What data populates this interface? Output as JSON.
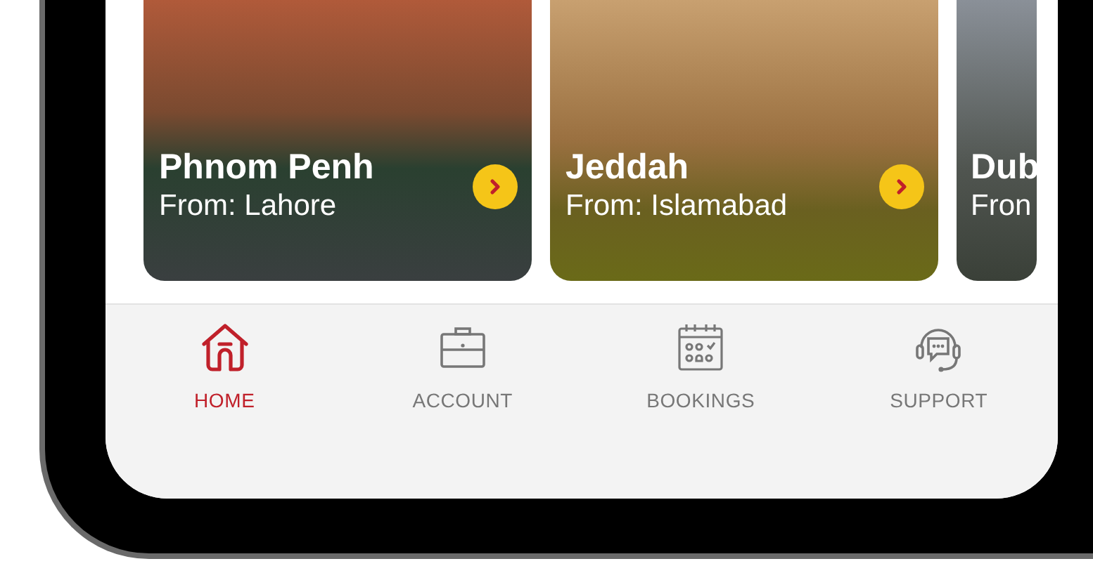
{
  "destinations": [
    {
      "title": "Phnom Penh",
      "origin": "From: Lahore",
      "arrow": true
    },
    {
      "title": "Jeddah",
      "origin": "From: Islamabad",
      "arrow": true
    },
    {
      "title": "Dub",
      "origin": "Fron",
      "arrow": false
    }
  ],
  "tab_bar": [
    {
      "label": "HOME",
      "kind": "home",
      "selected": true
    },
    {
      "label": "ACCOUNT",
      "kind": "account",
      "selected": false
    },
    {
      "label": "BOOKINGS",
      "kind": "bookings",
      "selected": false
    },
    {
      "label": "SUPPORT",
      "kind": "support",
      "selected": false
    }
  ]
}
